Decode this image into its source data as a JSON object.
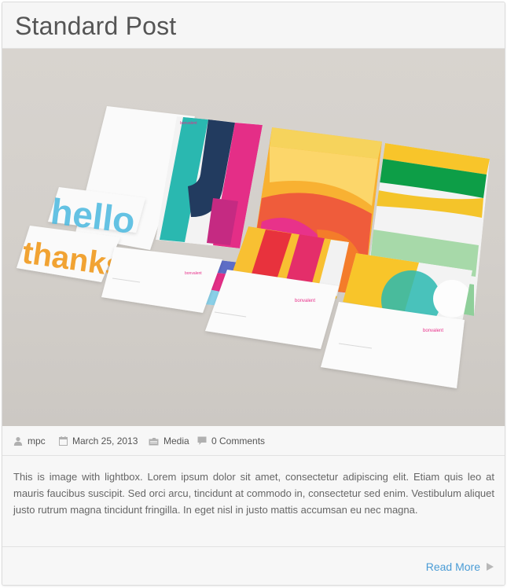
{
  "post": {
    "title": "Standard Post",
    "image": {
      "alt": "Stationery mockup"
    },
    "meta": {
      "author": "mpc",
      "date": "March 25, 2013",
      "category": "Media",
      "comments": "0 Comments"
    },
    "excerpt": "This is image with lightbox. Lorem ipsum dolor sit amet, consectetur adipiscing elit. Etiam quis leo at mauris faucibus suscipit. Sed orci arcu, tincidunt at commodo in, consectetur sed enim. Vestibulum aliquet justo rutrum magna tincidunt fringilla. In eget nisl in justo mattis accumsan eu nec magna.",
    "read_more": "Read More"
  },
  "mockup_text": {
    "hello": "hello",
    "thanks": "thanks",
    "brand": "bonvalent"
  },
  "icons": {
    "author": "user-icon",
    "date": "calendar-icon",
    "category": "folder-icon",
    "comments": "comment-icon",
    "read_more": "play-arrow-icon"
  },
  "colors": {
    "link": "#4a9cd6",
    "meta_icon": "#b0b0b0"
  }
}
